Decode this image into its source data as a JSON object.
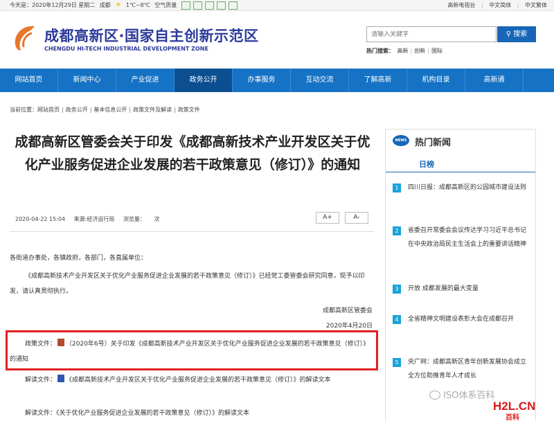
{
  "topbar": {
    "date": "今天是：2020年12月29日 星期二",
    "city": "成都",
    "temperature": "1℃~8℃",
    "air_quality": "空气质量",
    "links": [
      "高新电视台",
      "中文简体",
      "中文繁体"
    ]
  },
  "header": {
    "title": "成都高新区·国家自主创新示范区",
    "subtitle": "CHENGDU HI-TECH INDUSTRIAL DEVELOPMENT ZONE",
    "search_placeholder": "请输入关键字",
    "search_button": "搜索",
    "hot_search_label": "热门搜索：",
    "hot_search_terms": [
      "高新",
      "创新",
      "国际"
    ]
  },
  "nav": [
    "网站首页",
    "新闻中心",
    "产业促进",
    "政务公开",
    "办事服务",
    "互动交流",
    "了解高新",
    "机构目录",
    "高新通"
  ],
  "nav_active": "政务公开",
  "breadcrumb": [
    "当前位置：",
    "网站首页",
    "政务公开",
    "基本信息公开",
    "政策文件及解读",
    "政策文件"
  ],
  "article": {
    "title": "成都高新区管委会关于印发《成都高新技术产业开发区关于优化产业服务促进企业发展的若干政策意见（修订）》的通知",
    "date": "2020-04-22 15:04",
    "source": "来源:经济运行局",
    "views_label": "浏览量：",
    "views_unit": "次",
    "font_increase": "A+",
    "font_decrease": "A-",
    "salutation": "各街道办事处，各镇政府，各部门，各直属单位：",
    "body": "《成都高新技术产业开发区关于优化产业服务促进企业发展的若干政策意见（修订）》已经党工委管委会研究同意，现予以印发，请认真贯彻执行。",
    "signature": "成都高新区管委会",
    "sign_date": "2020年4月20日",
    "policy_label": "政策文件：",
    "policy_text": "（2020年6号）关于印发《成都高新技术产业开发区关于优化产业服务促进企业发展的若干政策意见（修订）》的通知",
    "interp_label": "解读文件：",
    "interp_text_1": "《成都高新技术产业开发区关于优化产业服务促进企业发展的若干政策意见（修订）》的解读文本",
    "interp_text_2": "《关于优化产业服务促进企业发展的若干政策意见（修订）》的解读文本"
  },
  "sidebar": {
    "badge": "NEWS",
    "title": "热门新闻",
    "tab": "日榜",
    "items": [
      {
        "num": "1",
        "text": "四川日报：成都高新区的公园城市建设法则"
      },
      {
        "num": "2",
        "text": "省委召开常委会会议传达学习习近平总书记在中央政治局民主生活会上的重要讲话精神"
      },
      {
        "num": "3",
        "text": "开放 成都发展的最大变量"
      },
      {
        "num": "4",
        "text": "全省精神文明建设表彰大会在成都召开"
      },
      {
        "num": "5",
        "text": "央广网：成都高新区青年创新发展协会成立 全方位助推青年人才成长"
      }
    ]
  },
  "watermark": {
    "wechat": "ISO体系百科",
    "site": "H2L.CN",
    "site_cn": "百科"
  }
}
